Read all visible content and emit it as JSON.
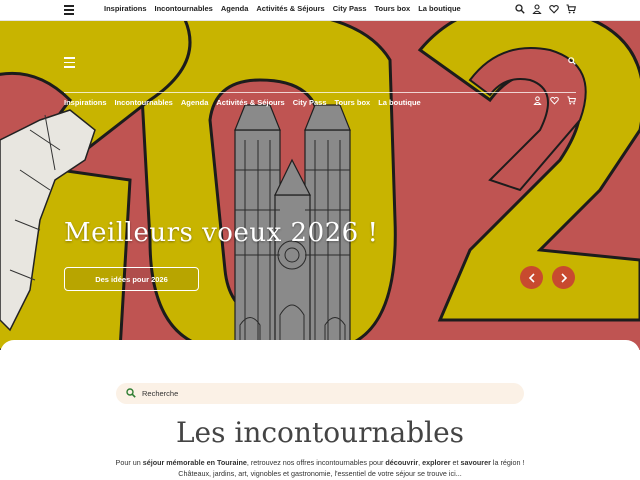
{
  "topbar": {
    "nav": [
      "Inspirations",
      "Incontournables",
      "Agenda",
      "Activités & Séjours",
      "City Pass",
      "Tours box",
      "La boutique"
    ],
    "icons": [
      "menu-icon",
      "search-icon",
      "user-icon",
      "heart-icon",
      "cart-icon"
    ]
  },
  "hero": {
    "nav": [
      "Inspirations",
      "Incontournables",
      "Agenda",
      "Activités & Séjours",
      "City Pass",
      "Tours box",
      "La boutique"
    ],
    "title": "Meilleurs voeux 2026 !",
    "cta_label": "Des idées pour 2026",
    "colors": {
      "red": "#c0544f",
      "yellow": "#c8b200",
      "arrow": "#c84a2f"
    }
  },
  "search": {
    "placeholder": "Recherche"
  },
  "section": {
    "title": "Les incontournables",
    "intro_1": "Pour un ",
    "intro_b1": "séjour mémorable en Touraine",
    "intro_2": ", retrouvez nos offres incontournables pour ",
    "intro_b2": "découvrir",
    "intro_3": ", ",
    "intro_b3": "explorer",
    "intro_4": " et ",
    "intro_b4": "savourer",
    "intro_5": " la région !",
    "line2": "Châteaux, jardins, art, vignobles et gastronomie, l'essentiel de votre séjour se trouve ici..."
  }
}
